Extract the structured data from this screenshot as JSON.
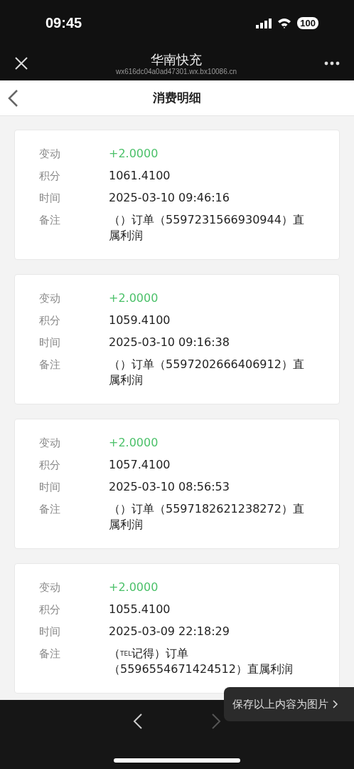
{
  "status_bar": {
    "time": "09:45",
    "battery": "100"
  },
  "nav_bar": {
    "title": "华南快充",
    "subtitle": "wx616dc04a0ad47301.wx.bx10086.cn"
  },
  "header": {
    "title": "消费明细"
  },
  "records": [
    {
      "fields": [
        {
          "label": "变动",
          "value": "+2.0000",
          "kind": "change"
        },
        {
          "label": "积分",
          "value": "1061.4100",
          "kind": "plain"
        },
        {
          "label": "时间",
          "value": "2025-03-10 09:46:16",
          "kind": "plain"
        },
        {
          "label": "备注",
          "value": "（）订单（5597231566930944）直属利润",
          "kind": "plain"
        }
      ]
    },
    {
      "fields": [
        {
          "label": "变动",
          "value": "+2.0000",
          "kind": "change"
        },
        {
          "label": "积分",
          "value": "1059.4100",
          "kind": "plain"
        },
        {
          "label": "时间",
          "value": "2025-03-10 09:16:38",
          "kind": "plain"
        },
        {
          "label": "备注",
          "value": "（）订单（5597202666406912）直属利润",
          "kind": "plain"
        }
      ]
    },
    {
      "fields": [
        {
          "label": "变动",
          "value": "+2.0000",
          "kind": "change"
        },
        {
          "label": "积分",
          "value": "1057.4100",
          "kind": "plain"
        },
        {
          "label": "时间",
          "value": "2025-03-10 08:56:53",
          "kind": "plain"
        },
        {
          "label": "备注",
          "value": "（）订单（5597182621238272）直属利润",
          "kind": "plain"
        }
      ]
    },
    {
      "fields": [
        {
          "label": "变动",
          "value": "+2.0000",
          "kind": "change"
        },
        {
          "label": "积分",
          "value": "1055.4100",
          "kind": "plain"
        },
        {
          "label": "时间",
          "value": "2025-03-09 22:18:29",
          "kind": "plain"
        },
        {
          "label": "备注",
          "value": "（$^{TEL}$记得）订单（5596554671424512）直属利润",
          "kind": "plain"
        }
      ]
    }
  ],
  "toast": {
    "text": "保存以上内容为图片"
  },
  "bottom_bar": {
    "back": {
      "disabled": false
    },
    "forward": {
      "disabled": true
    }
  }
}
